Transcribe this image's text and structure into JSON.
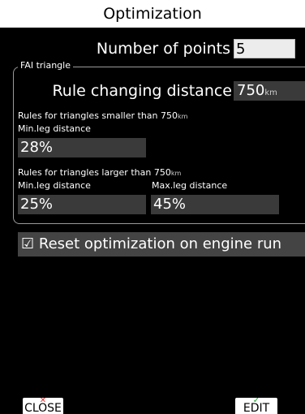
{
  "title": "Optimization",
  "number_of_points": {
    "label": "Number of points",
    "value": "5"
  },
  "fai_triangle": {
    "legend": "FAI triangle",
    "rule_changing_distance": {
      "label": "Rule changing distance",
      "value": "750",
      "unit": "km"
    },
    "smaller": {
      "heading": "Rules for triangles smaller than 750",
      "heading_unit": "km",
      "min_leg_label": "Min.leg distance",
      "min_leg_value": "28%"
    },
    "larger": {
      "heading": "Rules for triangles larger than 750",
      "heading_unit": "km",
      "min_leg_label": "Min.leg distance",
      "min_leg_value": "25%",
      "max_leg_label": "Max.leg distance",
      "max_leg_value": "45%"
    }
  },
  "reset_option": {
    "checkbox": "☑",
    "label": "Reset optimization on engine run"
  },
  "buttons": {
    "close": {
      "label": "CLOSE",
      "icon": "close-icon"
    },
    "edit": {
      "label": "EDIT",
      "icon": "check-icon"
    }
  },
  "colors": {
    "background": "#000000",
    "field": "#3a3a3a",
    "title_bg": "#ffffff"
  }
}
